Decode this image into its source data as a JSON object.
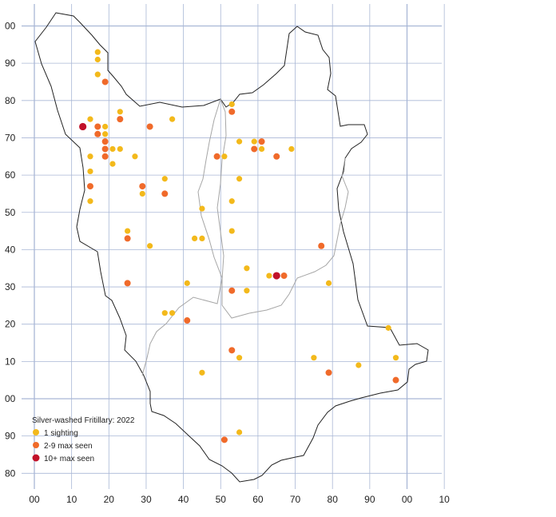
{
  "colors": {
    "grid": "#a9b7d6",
    "boundary": "#222222",
    "district_boundary": "#a6a6a6",
    "one_sighting": "#f3b91b",
    "two_to_nine": "#f06a2a",
    "ten_plus": "#c1122a"
  },
  "legend": {
    "title": "Silver-washed Fritillary:  2022",
    "items": [
      {
        "label": "1 sighting",
        "category": "one"
      },
      {
        "label": "2-9 max seen",
        "category": "mid"
      },
      {
        "label": "10+ max seen",
        "category": "high"
      }
    ]
  },
  "axes": {
    "x_ticks": [
      "00",
      "10",
      "20",
      "30",
      "40",
      "50",
      "60",
      "70",
      "80",
      "90",
      "00",
      "10"
    ],
    "y_ticks": [
      "00",
      "90",
      "80",
      "70",
      "60",
      "50",
      "40",
      "30",
      "20",
      "10",
      "00",
      "90",
      "80"
    ]
  },
  "chart_data": {
    "type": "scatter",
    "x_range": [
      0,
      110
    ],
    "y_range": [
      80,
      205
    ],
    "y_note": "continuous northing in km; labels wrap every 100",
    "series": [
      {
        "name": "1 sighting",
        "category": "one",
        "points": [
          [
            17,
            193
          ],
          [
            17,
            191
          ],
          [
            17,
            187
          ],
          [
            15,
            175
          ],
          [
            19,
            173
          ],
          [
            19,
            171
          ],
          [
            23,
            177
          ],
          [
            21,
            167
          ],
          [
            23,
            167
          ],
          [
            15,
            165
          ],
          [
            27,
            165
          ],
          [
            21,
            163
          ],
          [
            15,
            161
          ],
          [
            15,
            153
          ],
          [
            29,
            155
          ],
          [
            25,
            145
          ],
          [
            31,
            141
          ],
          [
            35,
            159
          ],
          [
            37,
            175
          ],
          [
            43,
            143
          ],
          [
            45,
            143
          ],
          [
            45,
            151
          ],
          [
            41,
            131
          ],
          [
            35,
            123
          ],
          [
            37,
            123
          ],
          [
            45,
            107
          ],
          [
            53,
            179
          ],
          [
            55,
            169
          ],
          [
            59,
            169
          ],
          [
            61,
            167
          ],
          [
            69,
            167
          ],
          [
            51,
            165
          ],
          [
            55,
            159
          ],
          [
            53,
            153
          ],
          [
            53,
            145
          ],
          [
            57,
            135
          ],
          [
            63,
            133
          ],
          [
            57,
            129
          ],
          [
            79,
            131
          ],
          [
            75,
            111
          ],
          [
            87,
            109
          ],
          [
            95,
            119
          ],
          [
            97,
            111
          ],
          [
            55,
            111
          ],
          [
            55,
            91
          ]
        ]
      },
      {
        "name": "2-9 max seen",
        "category": "mid",
        "points": [
          [
            19,
            185
          ],
          [
            17,
            173
          ],
          [
            17,
            171
          ],
          [
            19,
            169
          ],
          [
            19,
            167
          ],
          [
            19,
            165
          ],
          [
            23,
            175
          ],
          [
            31,
            173
          ],
          [
            15,
            157
          ],
          [
            29,
            157
          ],
          [
            35,
            155
          ],
          [
            25,
            143
          ],
          [
            25,
            131
          ],
          [
            41,
            121
          ],
          [
            53,
            177
          ],
          [
            61,
            169
          ],
          [
            59,
            167
          ],
          [
            49,
            165
          ],
          [
            65,
            165
          ],
          [
            77,
            141
          ],
          [
            67,
            133
          ],
          [
            53,
            129
          ],
          [
            53,
            113
          ],
          [
            79,
            107
          ],
          [
            97,
            105
          ],
          [
            51,
            89
          ]
        ]
      },
      {
        "name": "10+ max seen",
        "category": "high",
        "points": [
          [
            13,
            173
          ],
          [
            65,
            133
          ]
        ]
      }
    ]
  }
}
